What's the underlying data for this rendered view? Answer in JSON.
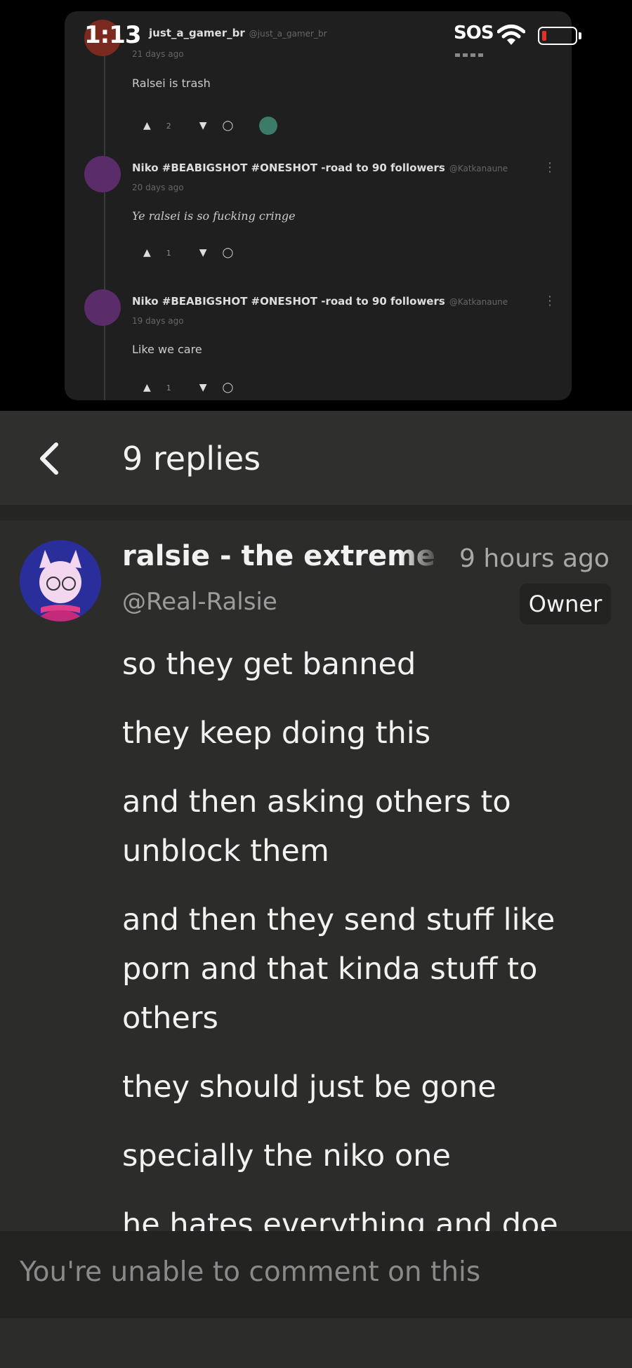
{
  "status_bar": {
    "time": "1:13",
    "sos": "SOS"
  },
  "embedded_screenshot": {
    "comments": [
      {
        "author": "just_a_gamer_br",
        "handle": "@just_a_gamer_br",
        "time": "21 days ago",
        "text": "Ralsei is trash",
        "likes": "2"
      },
      {
        "author": "Niko #BEABIGSHOT #ONESHOT -road to 90 followers",
        "handle": "@Katkanaune",
        "time": "20 days ago",
        "text": "Ye ralsei is so fucking cringe",
        "likes": "1"
      },
      {
        "author": "Niko #BEABIGSHOT #ONESHOT -road to 90 followers",
        "handle": "@Katkanaune",
        "time": "19 days ago",
        "text": "Like we care",
        "likes": "1"
      }
    ]
  },
  "header": {
    "title": "9 replies"
  },
  "comment": {
    "author": "ralsie - the extreme",
    "time": "9 hours ago",
    "handle": "@Real-Ralsie",
    "badge": "Owner",
    "lines": [
      "so they get banned",
      "they keep doing this",
      "and then asking others to unblock them",
      "and then they send stuff like porn and that kinda stuff to others",
      "they should just be gone",
      "specially the niko one",
      "he hates everything and doe"
    ]
  },
  "footer": {
    "placeholder": "You're unable to comment on this"
  },
  "colors": {
    "background": "#2c2c2a",
    "header": "#2f2f2d",
    "footer": "#232322",
    "avatar_bg": "#2a2e9a",
    "battery_low": "#e0312b"
  }
}
